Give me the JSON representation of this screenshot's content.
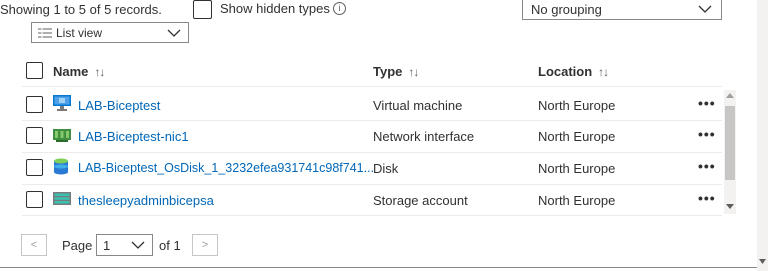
{
  "toolbar": {
    "records_text": "Showing 1 to 5 of 5 records.",
    "show_hidden_label": "Show hidden types",
    "info_icon": "info-icon",
    "grouping_value": "No grouping",
    "view_value": "List view",
    "view_icon": "list-icon"
  },
  "table": {
    "headers": {
      "name": "Name",
      "type": "Type",
      "location": "Location"
    },
    "sort_glyph": "↑↓",
    "more_label": "•••",
    "rows": [
      {
        "name": "LAB-Biceptest",
        "type": "Virtual machine",
        "location": "North Europe",
        "icon": "virtual-machine-icon"
      },
      {
        "name": "LAB-Biceptest-nic1",
        "type": "Network interface",
        "location": "North Europe",
        "icon": "network-interface-icon"
      },
      {
        "name": "LAB-Biceptest_OsDisk_1_3232efea931741c98f741...",
        "type": "Disk",
        "location": "North Europe",
        "icon": "disk-icon"
      },
      {
        "name": "thesleepyadminbicepsa",
        "type": "Storage account",
        "location": "North Europe",
        "icon": "storage-account-icon"
      }
    ]
  },
  "pager": {
    "prev": "<",
    "next": ">",
    "page_label": "Page",
    "page_value": "1",
    "of_label": "of 1"
  }
}
